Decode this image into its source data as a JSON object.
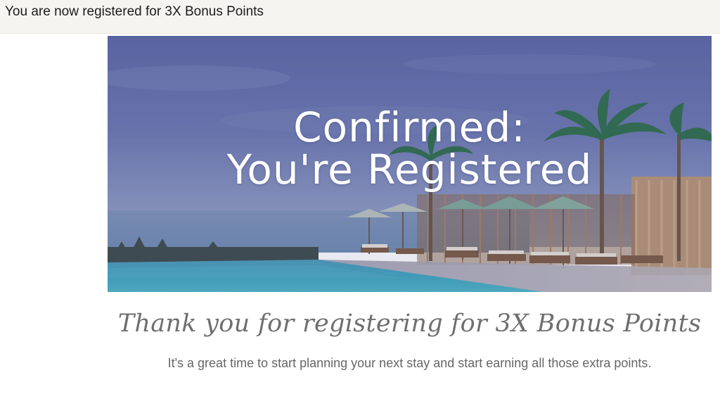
{
  "email": {
    "subject": "You are now registered for 3X Bonus Points"
  },
  "hero": {
    "headline_line1": "Confirmed:",
    "headline_line2": "You're Registered",
    "image_subject": "infinity-pool-resort-with-palm-trees-and-umbrellas"
  },
  "content": {
    "thanks_heading": "Thank you for registering for 3X Bonus Points",
    "body_text": "It's a great time to start planning your next stay and start earning all those extra points."
  },
  "colors": {
    "topbar_bg": "#f6f4f1",
    "heading_gray": "#6f6f6f",
    "body_gray": "#666666",
    "sky_purple": "#5f6aa6",
    "pool_blue": "#3f9fb5"
  }
}
